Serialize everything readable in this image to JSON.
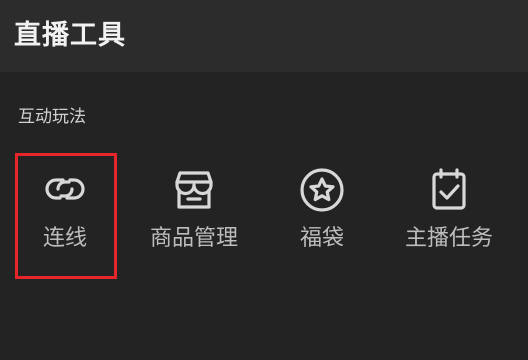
{
  "header": {
    "title": "直播工具"
  },
  "section": {
    "title": "互动玩法"
  },
  "tools": [
    {
      "label": "连线",
      "icon": "link-icon",
      "selected": true
    },
    {
      "label": "商品管理",
      "icon": "storefront-icon",
      "selected": false
    },
    {
      "label": "福袋",
      "icon": "star-badge-icon",
      "selected": false
    },
    {
      "label": "主播任务",
      "icon": "calendar-check-icon",
      "selected": false
    }
  ],
  "colors": {
    "background": "#232323",
    "header": "#2c2c2c",
    "icon": "#d8d8d8",
    "label": "#bdbdbd",
    "highlight": "#e5262b"
  }
}
